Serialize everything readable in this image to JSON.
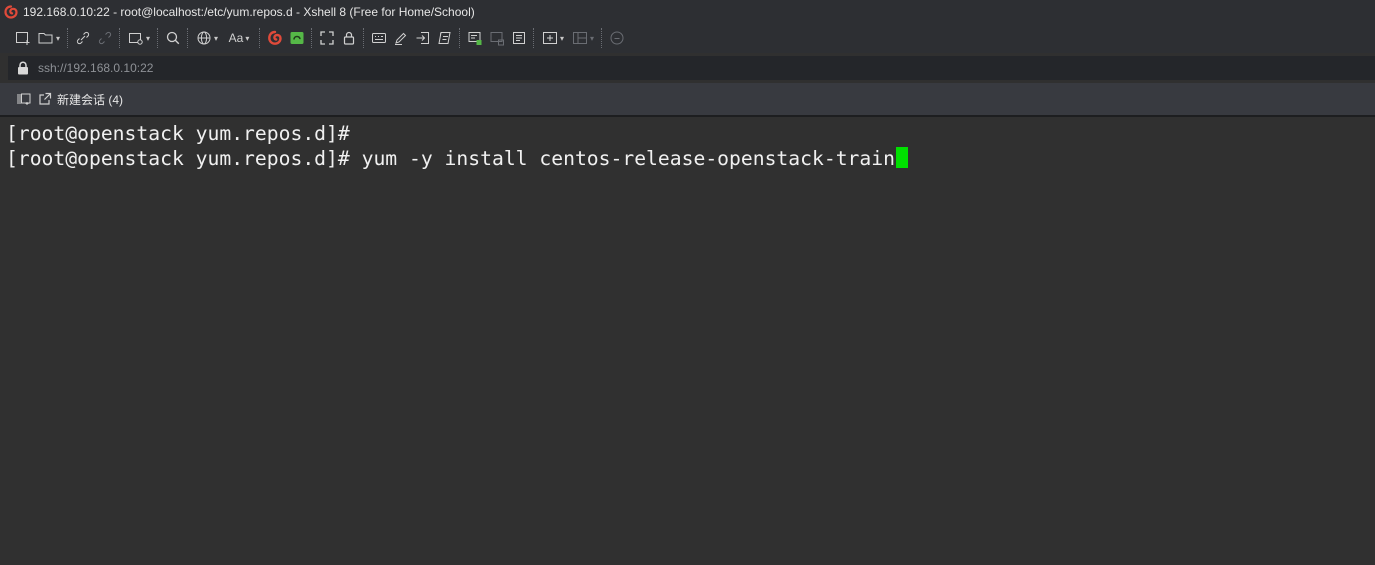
{
  "window": {
    "title": "192.168.0.10:22 - root@localhost:/etc/yum.repos.d - Xshell 8 (Free for Home/School)"
  },
  "toolbar": {
    "font_button_label": "Aa"
  },
  "address": {
    "url": "ssh://192.168.0.10:22"
  },
  "tabs": {
    "new_session_label": "新建会话 (4)"
  },
  "terminal": {
    "lines": [
      "[root@openstack yum.repos.d]#",
      "[root@openstack yum.repos.d]# yum -y install centos-release-openstack-train"
    ],
    "cursor_color": "#00e000"
  },
  "colors": {
    "accent_red": "#e04a3a",
    "accent_green": "#55b847",
    "background": "#303030"
  }
}
